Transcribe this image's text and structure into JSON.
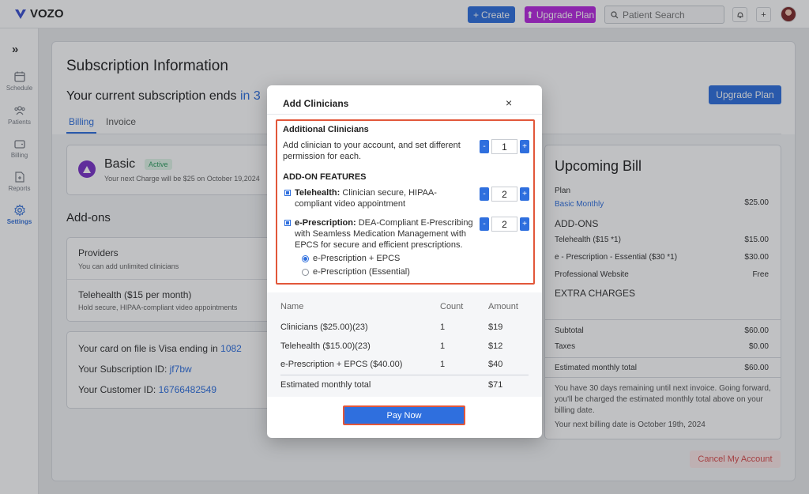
{
  "app": {
    "brand": "VOZO"
  },
  "topbar": {
    "create_label": "Create",
    "upgrade_label": "Upgrade Plan",
    "search_placeholder": "Patient Search"
  },
  "sidebar": {
    "items": [
      {
        "label": "Schedule",
        "icon": "calendar-icon"
      },
      {
        "label": "Patients",
        "icon": "patients-icon"
      },
      {
        "label": "Billing",
        "icon": "wallet-icon"
      },
      {
        "label": "Reports",
        "icon": "report-icon"
      },
      {
        "label": "Settings",
        "icon": "gear-icon",
        "active": true
      }
    ]
  },
  "page": {
    "title": "Subscription Information",
    "subscription_ends_text": "Your current subscription ends",
    "subscription_ends_link": "in 3",
    "upgrade_button": "Upgrade Plan",
    "tabs": [
      {
        "label": "Billing",
        "active": true
      },
      {
        "label": "Invoice",
        "active": false
      }
    ],
    "plan": {
      "name": "Basic",
      "badge": "Active",
      "note": "Your next Charge will be $25 on October 19,2024"
    },
    "addons_title": "Add-ons",
    "addons": [
      {
        "name": "Providers",
        "desc": "You can add unlimited clinicians"
      },
      {
        "name": "Telehealth ($15 per month)",
        "desc": "Hold secure, HIPAA-compliant video appointments"
      }
    ],
    "account": {
      "card_text": "Your card on file is Visa ending in",
      "card_last4": "1082",
      "subscription_id_label": "Your Subscription ID:",
      "subscription_id": "jf7bw",
      "customer_id_label": "Your Customer ID:",
      "customer_id": "16766482549"
    },
    "bill": {
      "title": "Upcoming Bill",
      "plan_label": "Plan",
      "plan_name": "Basic Monthly",
      "plan_price": "$25.00",
      "addons_heading": "ADD-ONS",
      "addon_lines": [
        {
          "label": "Telehealth  ($15 *1)",
          "value": "$15.00"
        },
        {
          "label": "e - Prescription - Essential ($30 *1)",
          "value": "$30.00"
        },
        {
          "label": "Professional Website",
          "value": "Free"
        }
      ],
      "extra_heading": "EXTRA CHARGES",
      "subtotal_label": "Subtotal",
      "subtotal": "$60.00",
      "taxes_label": "Taxes",
      "taxes": "$0.00",
      "total_label": "Estimated monthly total",
      "total": "$60.00",
      "note": "You have 30 days remaining until next invoice. Going forward, you'll be charged the estimated monthly total above on your billing date.",
      "next_date": "Your next billing date is October 19th, 2024"
    },
    "cancel_button": "Cancel My Account"
  },
  "modal": {
    "title": "Add Clinicians",
    "close": "×",
    "additional_heading": "Additional Clinicians",
    "additional_text": "Add clinician to your account, and set different permission for each.",
    "clinician_count": "1",
    "addon_heading": "ADD-ON FEATURES",
    "telehealth_name": "Telehealth:",
    "telehealth_desc": " Clinician secure, HIPAA-compliant video appointment",
    "telehealth_count": "2",
    "erx_name": "e-Prescription:",
    "erx_desc": " DEA-Compliant E-Prescribing with Seamless Medication Management with EPCS for secure and efficient prescriptions.",
    "erx_count": "2",
    "erx_options": [
      {
        "label": "e-Prescription + EPCS",
        "selected": true
      },
      {
        "label": "e-Prescription (Essential)",
        "selected": false
      }
    ],
    "table": {
      "headers": [
        "Name",
        "Count",
        "Amount"
      ],
      "rows": [
        [
          "Clinicians  ($25.00)(23)",
          "1",
          "$19"
        ],
        [
          "Telehealth ($15.00)(23)",
          "1",
          "$12"
        ],
        [
          "e-Prescription + EPCS ($40.00)",
          "1",
          "$40"
        ]
      ],
      "total_label": "Estimated monthly total",
      "total": "$71"
    },
    "pay_button": "Pay Now",
    "step_minus": "-",
    "step_plus": "+"
  },
  "colors": {
    "accent": "#2f6fde",
    "upgrade": "#b827e0",
    "highlight": "#e2573a",
    "active_badge": "#2e9e60",
    "cancel": "#d94c4c"
  }
}
